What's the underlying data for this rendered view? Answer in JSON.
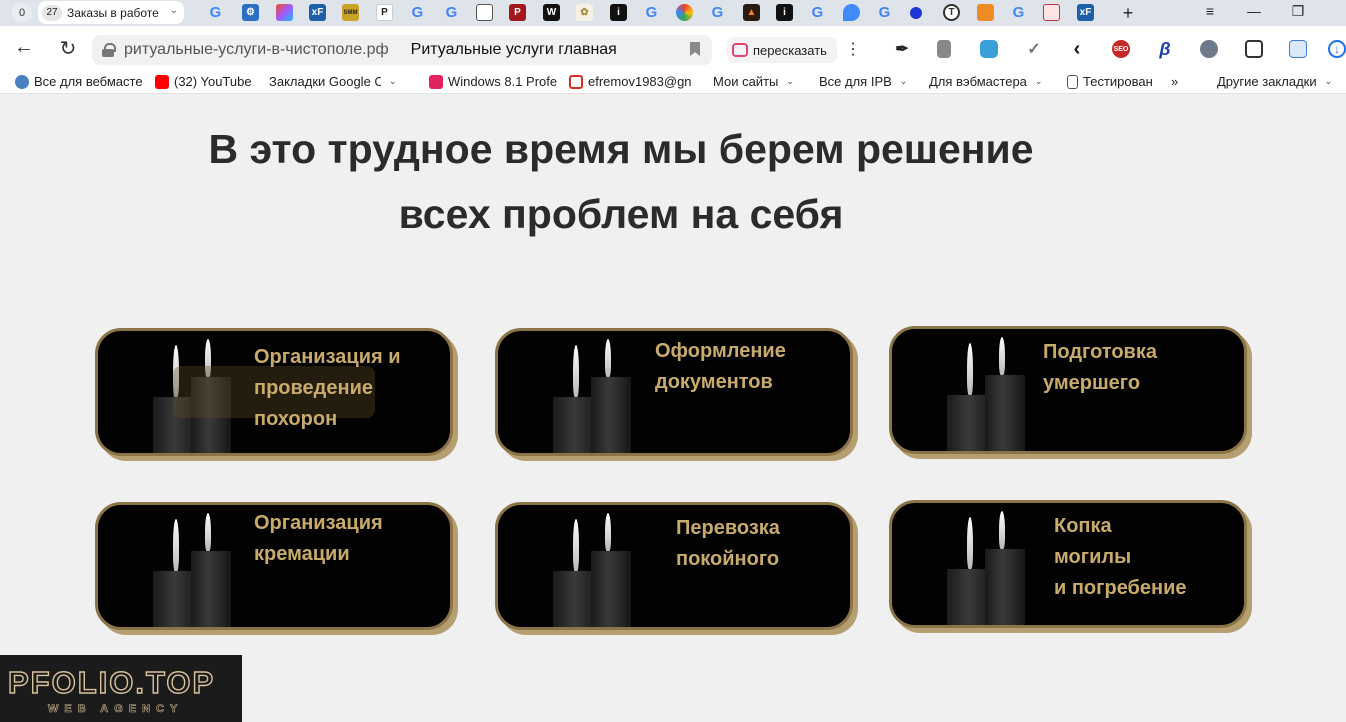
{
  "tabs": {
    "counter0": "0",
    "active": {
      "count": "27",
      "label": "Заказы в работе"
    }
  },
  "window": {
    "new_tab": "+",
    "menu": "≡",
    "minimize": "—",
    "restore": "❐"
  },
  "addressbar": {
    "url": "ритуальные-услуги-в-чистополе.рф",
    "title": "Ритуальные услуги главная",
    "retell": "пересказать"
  },
  "bookmarks": [
    {
      "label": "Все для вебмасте",
      "color": "#4a7fc1"
    },
    {
      "label": "(32) YouTube",
      "color": "#ff0000"
    },
    {
      "label": "Закладки Google Ch",
      "color": "#ffffff",
      "dropdown": true
    },
    {
      "label": "Windows 8.1 Profe",
      "color": "#e0245e"
    },
    {
      "label": "efremov1983@gn",
      "color": "#d93025"
    },
    {
      "label": "Мои сайты",
      "color": "#ffffff",
      "dropdown": true
    },
    {
      "label": "Все для IPB",
      "color": "#ffffff",
      "dropdown": true
    },
    {
      "label": "Для вэбмастера",
      "color": "#ffffff",
      "dropdown": true
    },
    {
      "label": "Тестирован",
      "color": "#ffffff"
    },
    {
      "label": "»",
      "color": "#ffffff"
    },
    {
      "label": "Другие закладки",
      "color": "#ffffff",
      "dropdown": true
    }
  ],
  "page": {
    "headline_line1": "В это трудное время мы берем решение",
    "headline_line2": "всех проблем на себя",
    "services": [
      "Организация и\nпроведение\nпохорон",
      "Оформление\nдокументов",
      "Подготовка\nумершего",
      "Организация\nкремации",
      "Перевозка\nпокойного",
      "Копка\nмогилы\nи погребение"
    ],
    "colors": {
      "card_bg": "#020202",
      "card_border": "#8b7445",
      "label": "#c8aa6a",
      "page_bg": "#f1f0f1"
    }
  },
  "watermark": {
    "title": "PFOLIO.TOP",
    "subtitle": "WEB AGENCY"
  }
}
